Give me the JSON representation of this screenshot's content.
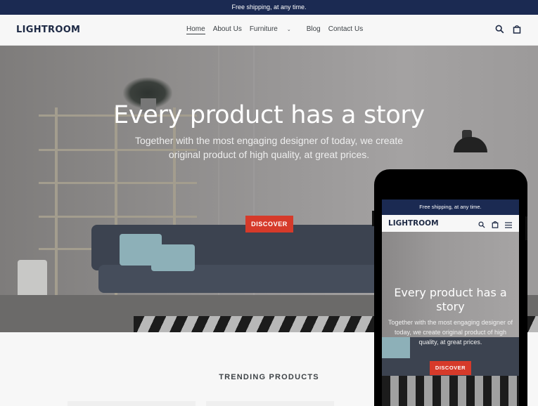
{
  "announcement": "Free shipping, at any time.",
  "header": {
    "logo": "LIGHTROOM",
    "nav": [
      {
        "label": "Home",
        "active": true
      },
      {
        "label": "About Us"
      },
      {
        "label": "Furniture",
        "has_dropdown": true
      },
      {
        "label": "Blog"
      },
      {
        "label": "Contact Us"
      }
    ],
    "icons": [
      "search-icon",
      "cart-icon"
    ]
  },
  "hero": {
    "title": "Every product has a story",
    "subtitle": "Together with the most engaging designer of today, we create original product of high quality, at great prices.",
    "button_label": "DISCOVER"
  },
  "trending": {
    "heading": "TRENDING PRODUCTS"
  },
  "mobile_preview": {
    "announcement": "Free shipping, at any time.",
    "logo": "LIGHTROOM",
    "icons": [
      "search-icon",
      "cart-icon",
      "menu-icon"
    ],
    "hero_title": "Every product has a story",
    "hero_subtitle": "Together with the most engaging designer of today, we create original product of high quality, at great prices.",
    "button_label": "DISCOVER"
  },
  "colors": {
    "announcement_bg": "#1b2a52",
    "accent": "#d63a2a",
    "logo": "#1e2a45"
  }
}
